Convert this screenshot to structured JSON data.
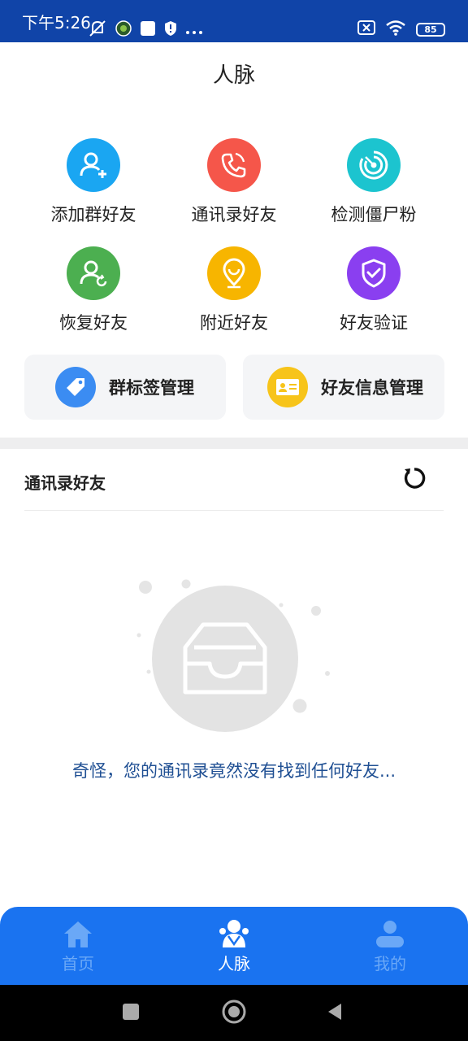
{
  "status_bar": {
    "time": "下午5:26",
    "battery": "85",
    "left_icons": [
      "mute-icon",
      "app-icon",
      "square-icon",
      "shield-icon",
      "more-icon"
    ],
    "right_icons": [
      "sim-off-icon",
      "wifi-icon",
      "battery-icon"
    ]
  },
  "header": {
    "title": "人脉"
  },
  "features": [
    {
      "label": "添加群好友",
      "icon": "add-user-icon",
      "color": "#1aa6f2"
    },
    {
      "label": "通讯录好友",
      "icon": "phone-icon",
      "color": "#f5564a"
    },
    {
      "label": "检测僵尸粉",
      "icon": "radar-icon",
      "color": "#1cc4cf"
    },
    {
      "label": "恢复好友",
      "icon": "restore-user-icon",
      "color": "#4caf50"
    },
    {
      "label": "附近好友",
      "icon": "location-icon",
      "color": "#f7b500"
    },
    {
      "label": "好友验证",
      "icon": "shield-check-icon",
      "color": "#8a3ff0"
    }
  ],
  "management": [
    {
      "label": "群标签管理",
      "icon": "tag-icon",
      "color": "#3b8cf2"
    },
    {
      "label": "好友信息管理",
      "icon": "id-card-icon",
      "color": "#f7c41a"
    }
  ],
  "section": {
    "title": "通讯录好友"
  },
  "empty_state": {
    "message": "奇怪，您的通讯录竟然没有找到任何好友..."
  },
  "bottom_nav": {
    "items": [
      {
        "label": "首页",
        "icon": "home-icon",
        "active": false
      },
      {
        "label": "人脉",
        "icon": "people-icon",
        "active": true
      },
      {
        "label": "我的",
        "icon": "profile-icon",
        "active": false
      }
    ]
  },
  "colors": {
    "status_bar": "#1044a8",
    "accent": "#1a73f0",
    "empty_text": "#1f4f93"
  }
}
